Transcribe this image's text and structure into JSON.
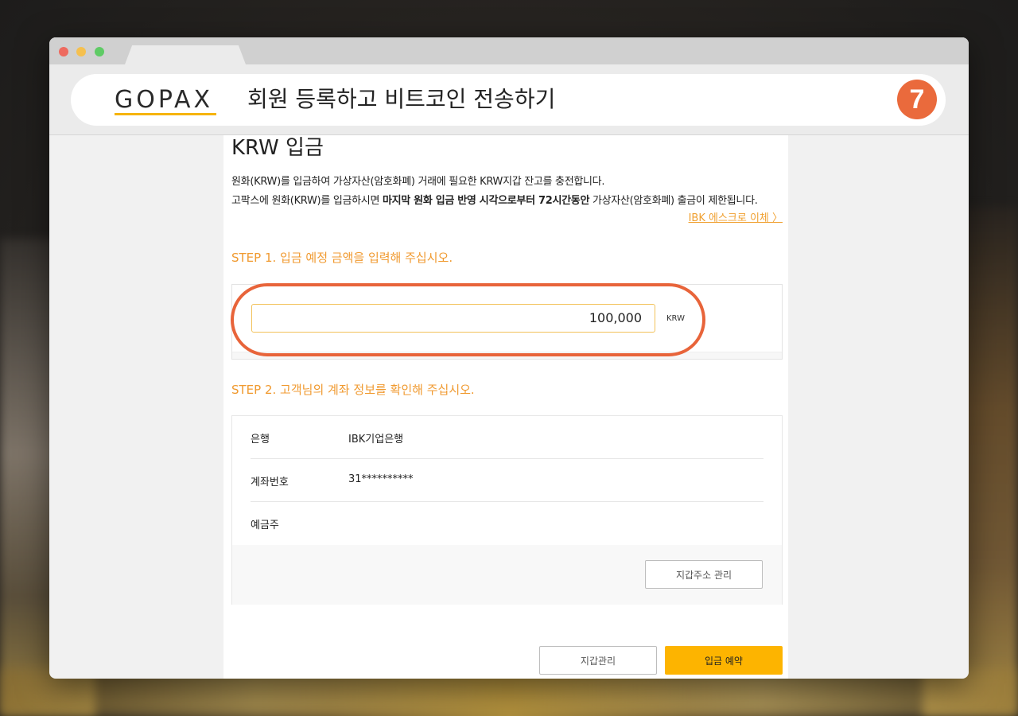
{
  "header": {
    "logo_text": "GOPAX",
    "title": "회원 등록하고 비트코인 전송하기",
    "step_number": "7"
  },
  "page": {
    "title": "KRW 입금",
    "desc_line1": "원화(KRW)를 입금하여 가상자산(암호화폐) 거래에 필요한 KRW지갑 잔고를 충전합니다.",
    "desc_line2_pre": "고팍스에 원화(KRW)를 입금하시면 ",
    "desc_line2_bold": "마지막 원화 입금 반영 시각으로부터 72시간동안",
    "desc_line2_post": " 가상자산(암호화폐) 출금이 제한됩니다.",
    "escrow_link": "IBK 에스크로 이체 〉"
  },
  "step1": {
    "heading": "STEP 1. 입금 예정 금액을 입력해 주십시오.",
    "amount": "100,000",
    "unit": "KRW"
  },
  "step2": {
    "heading": "STEP 2. 고객님의 계좌 정보를 확인해 주십시오.",
    "rows": [
      {
        "label": "은행",
        "value": "IBK기업은행"
      },
      {
        "label": "계좌번호",
        "value": "31**********"
      },
      {
        "label": "예금주",
        "value": ""
      }
    ],
    "wallet_address_button": "지갑주소 관리"
  },
  "actions": {
    "wallet_button": "지갑관리",
    "deposit_button": "입금 예약"
  },
  "colors": {
    "accent_orange": "#f09a30",
    "highlight_red": "#e8643a",
    "primary_yellow": "#fdb400"
  }
}
